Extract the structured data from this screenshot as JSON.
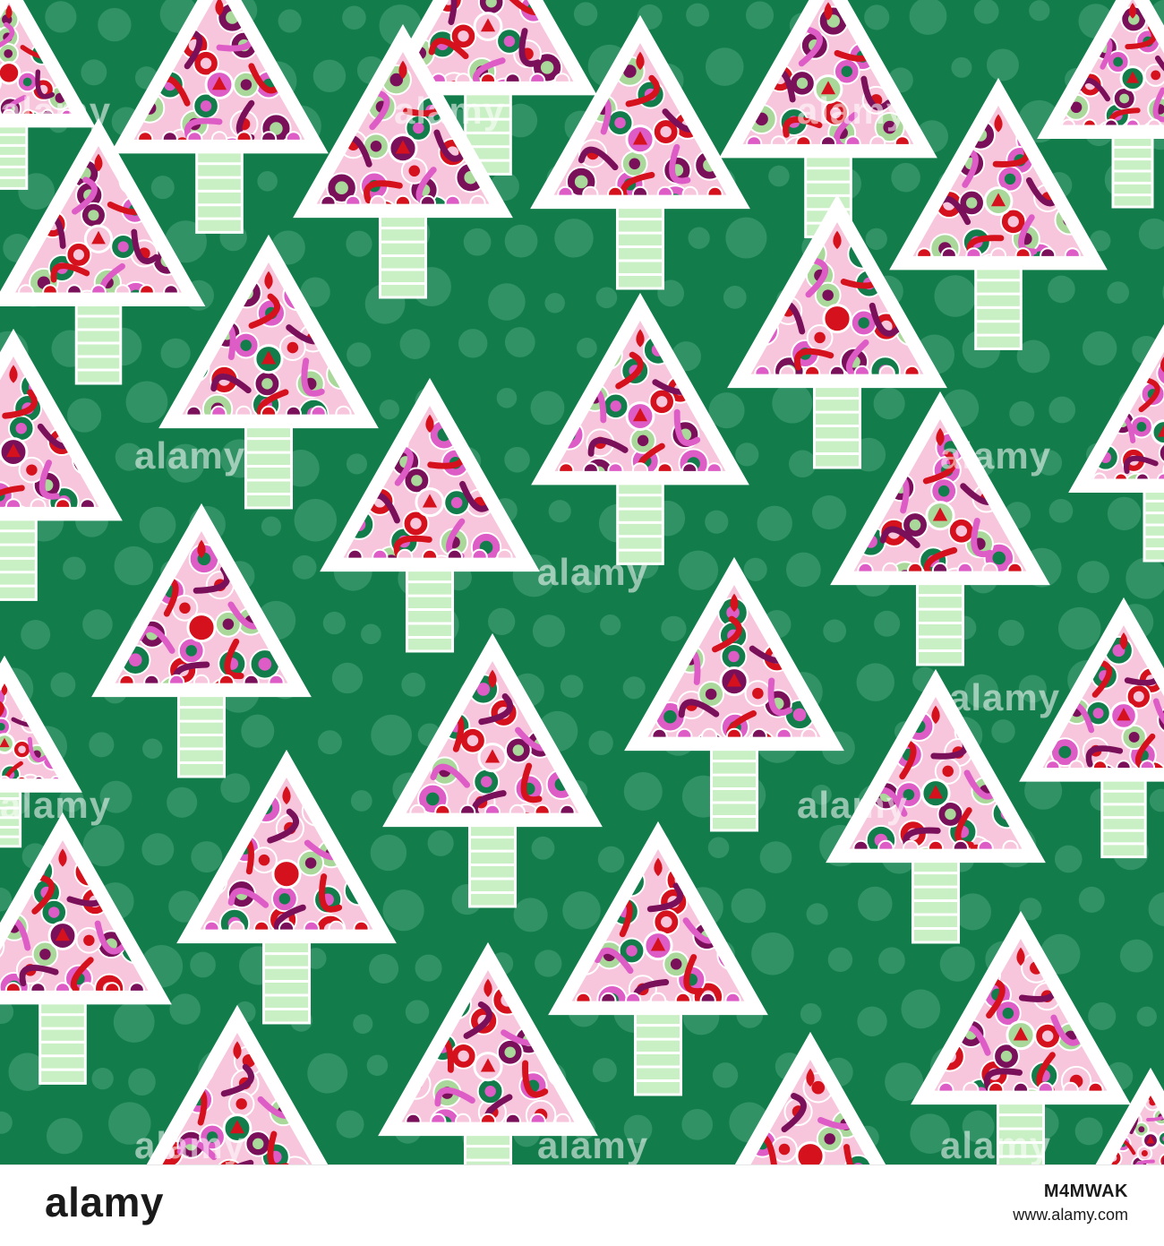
{
  "image": {
    "description_colors": {
      "background": "#127d4b",
      "dot": "#4aa47c",
      "tree_outline": "#ffffff",
      "trunk_fill": "#c9efc4",
      "ornament_red": "#d4111c",
      "ornament_purple": "#7a0f5a",
      "ornament_pink": "#de5cc6",
      "ornament_light_pink": "#f7c6dc",
      "ornament_sage": "#a9d89a",
      "ornament_green": "#127d4b"
    }
  },
  "watermarks": [
    "alamy",
    "alamy",
    "alamy",
    "alamy",
    "alamy",
    "alamy",
    "alamy",
    "alamy",
    "alamy",
    "alamy",
    "alamy",
    "alamy"
  ],
  "footer": {
    "logo": "alamy",
    "image_id": "M4MWAK",
    "url": "www.alamy.com"
  }
}
